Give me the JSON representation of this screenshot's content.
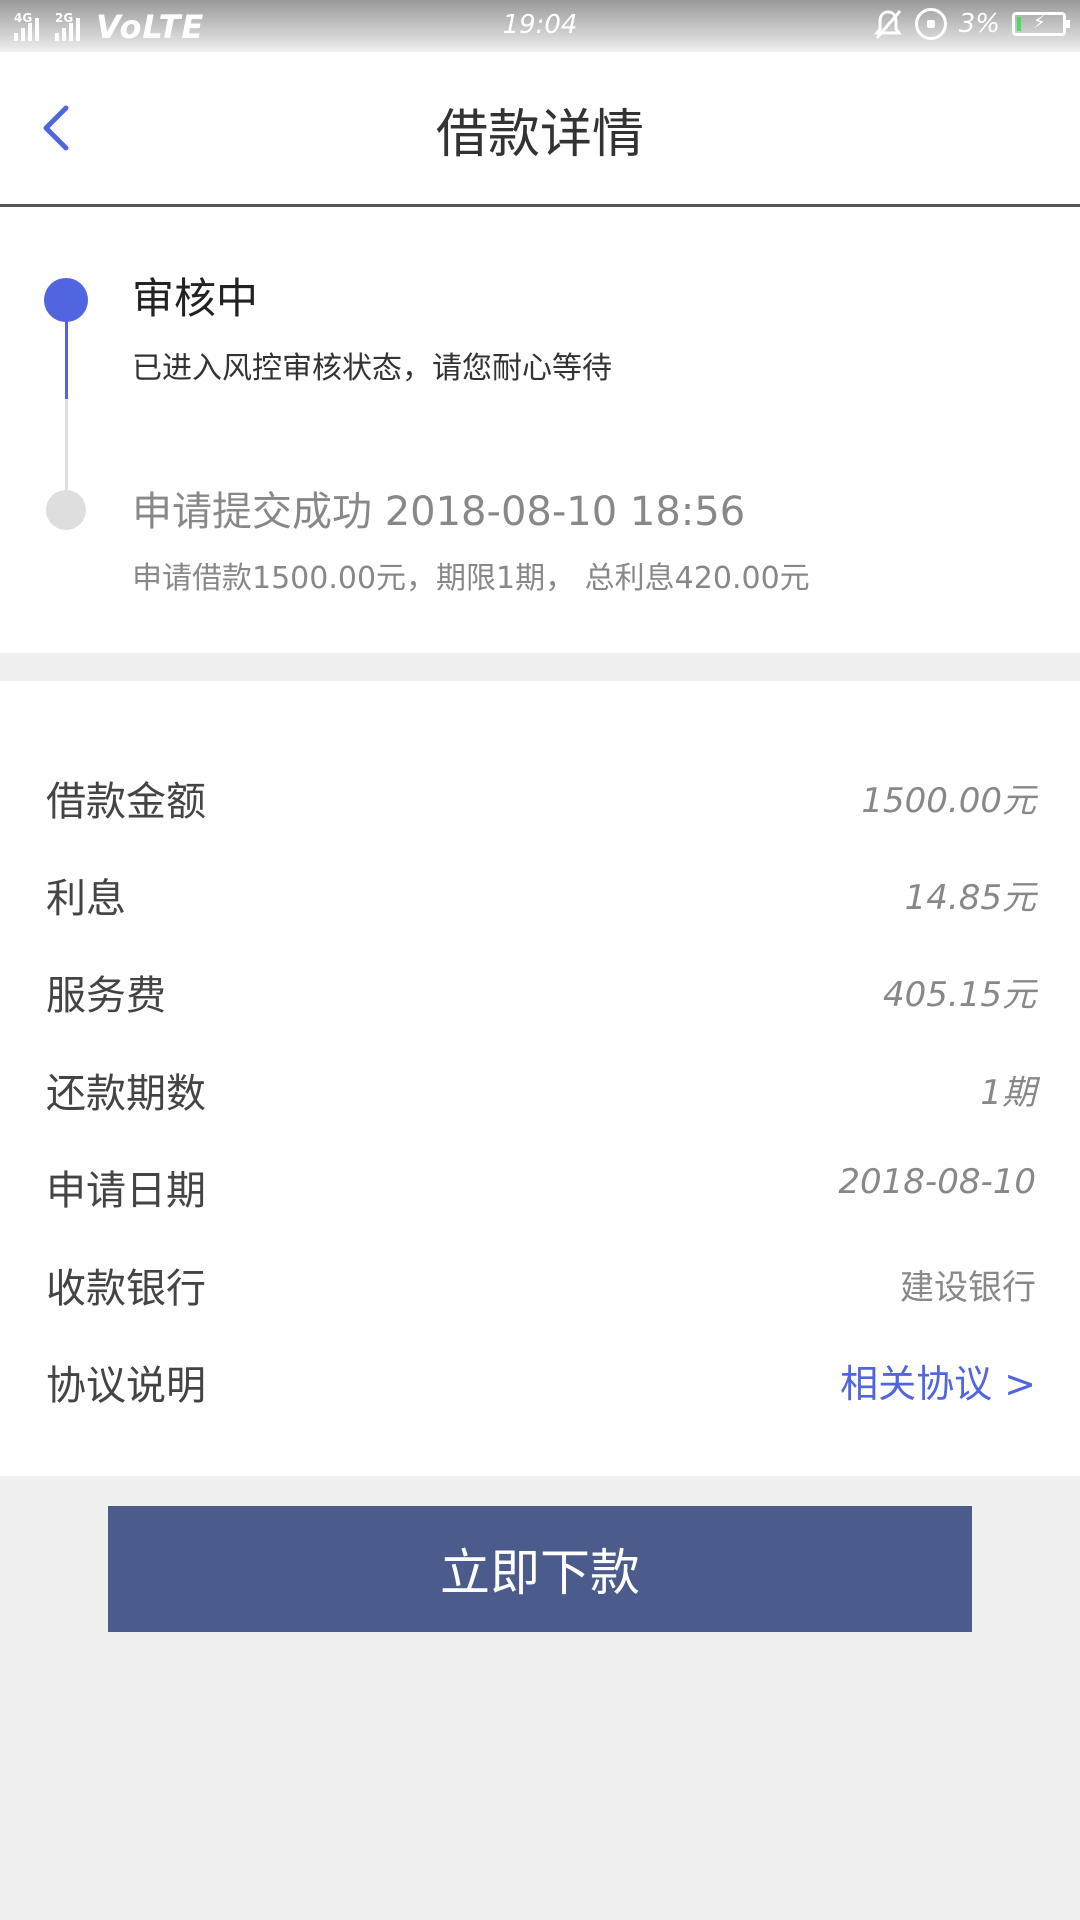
{
  "status_bar": {
    "network_1": "4G",
    "network_2": "2G",
    "volte": "VoLTE",
    "time": "19:04",
    "battery": "3%",
    "icons": [
      "signal-icon",
      "mute-icon",
      "rotation-lock-icon",
      "battery-icon"
    ]
  },
  "header": {
    "title": "借款详情",
    "back_icon": "chevron-left-icon"
  },
  "timeline": {
    "steps": [
      {
        "title": "审核中",
        "desc": "已进入风控审核状态，请您耐心等待",
        "state": "active"
      },
      {
        "title": "申请提交成功 2018-08-10 18:56",
        "desc": "申请借款1500.00元，期限1期，  总利息420.00元",
        "state": "done"
      }
    ]
  },
  "details": {
    "rows": [
      {
        "label": "借款金额",
        "value": "1500.00元"
      },
      {
        "label": "利息",
        "value": "14.85元"
      },
      {
        "label": "服务费",
        "value": "405.15元"
      },
      {
        "label": "还款期数",
        "value": "1期"
      },
      {
        "label": "申请日期",
        "value": "2018-08-10"
      },
      {
        "label": "收款银行",
        "value": "建设银行"
      },
      {
        "label": "协议说明",
        "value": "相关协议 >"
      }
    ]
  },
  "actions": {
    "primary": "立即下款"
  },
  "colors": {
    "accent": "#5165e0",
    "button": "#4a5b8c",
    "background": "#f0f0f0"
  }
}
